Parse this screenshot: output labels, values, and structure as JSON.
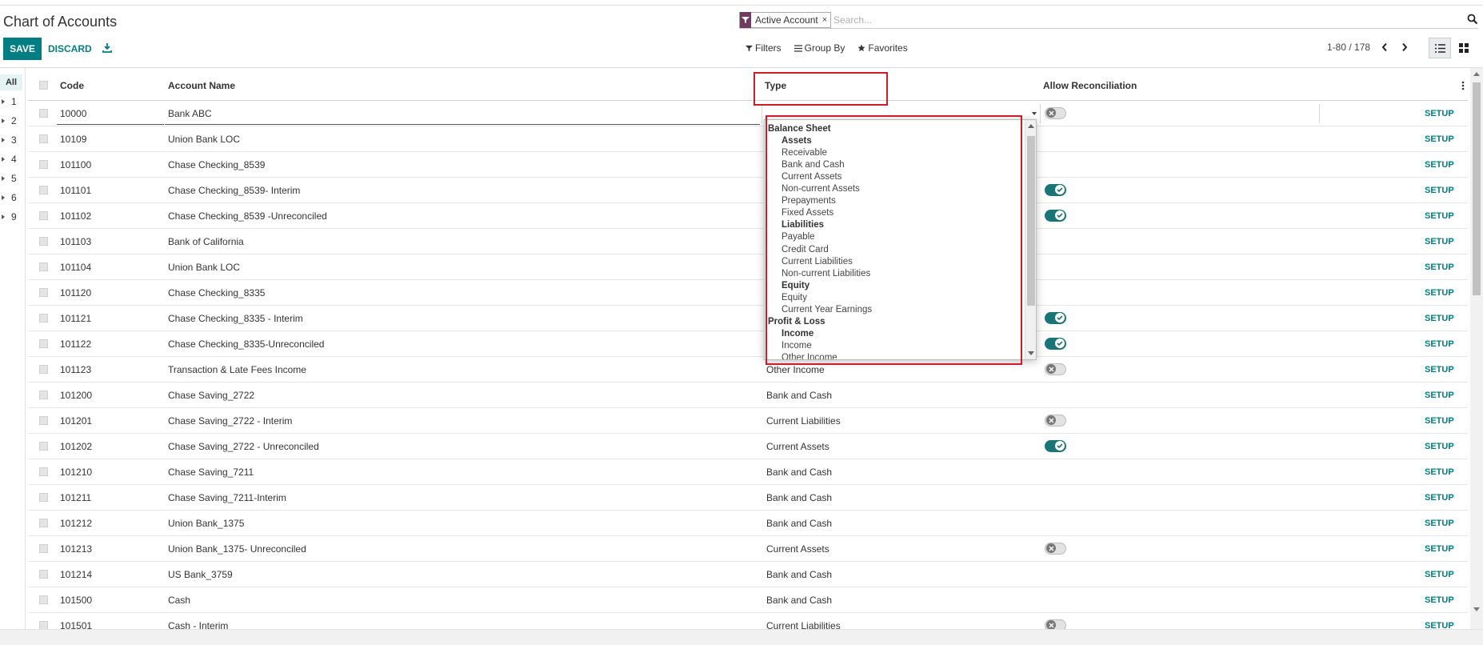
{
  "control_panel": {
    "title": "Chart of Accounts",
    "save_label": "SAVE",
    "discard_label": "DISCARD",
    "download_icon": "download-icon"
  },
  "search": {
    "facet_label": "Active Account",
    "facet_remove": "×",
    "placeholder": "Search..."
  },
  "actions": {
    "filters": "Filters",
    "group_by": "Group By",
    "favorites": "Favorites"
  },
  "pager": {
    "value": "1-80 / 178"
  },
  "search_panel": {
    "all_label": "All",
    "items": [
      "1",
      "2",
      "3",
      "4",
      "5",
      "6",
      "9"
    ]
  },
  "list": {
    "columns": {
      "code": "Code",
      "name": "Account Name",
      "type": "Type",
      "reconcile": "Allow Reconciliation"
    },
    "setup_label": "SETUP",
    "rows": [
      {
        "code": "10000",
        "name": "Bank ABC",
        "type": "",
        "reconcile": "off"
      },
      {
        "code": "10109",
        "name": "Union Bank LOC",
        "type": "",
        "reconcile": ""
      },
      {
        "code": "101100",
        "name": "Chase Checking_8539",
        "type": "",
        "reconcile": ""
      },
      {
        "code": "101101",
        "name": "Chase Checking_8539- Interim",
        "type": "",
        "reconcile": "on"
      },
      {
        "code": "101102",
        "name": "Chase Checking_8539 -Unreconciled",
        "type": "",
        "reconcile": "on"
      },
      {
        "code": "101103",
        "name": "Bank of California",
        "type": "",
        "reconcile": ""
      },
      {
        "code": "101104",
        "name": "Union Bank LOC",
        "type": "",
        "reconcile": ""
      },
      {
        "code": "101120",
        "name": "Chase Checking_8335",
        "type": "",
        "reconcile": ""
      },
      {
        "code": "101121",
        "name": "Chase Checking_8335 - Interim",
        "type": "",
        "reconcile": "on"
      },
      {
        "code": "101122",
        "name": "Chase Checking_8335-Unreconciled",
        "type": "",
        "reconcile": "on"
      },
      {
        "code": "101123",
        "name": "Transaction & Late Fees Income",
        "type": "Other Income",
        "reconcile": "off"
      },
      {
        "code": "101200",
        "name": "Chase Saving_2722",
        "type": "Bank and Cash",
        "reconcile": ""
      },
      {
        "code": "101201",
        "name": "Chase Saving_2722 - Interim",
        "type": "Current Liabilities",
        "reconcile": "off"
      },
      {
        "code": "101202",
        "name": "Chase Saving_2722 - Unreconciled",
        "type": "Current Assets",
        "reconcile": "on"
      },
      {
        "code": "101210",
        "name": "Chase Saving_7211",
        "type": "Bank and Cash",
        "reconcile": ""
      },
      {
        "code": "101211",
        "name": "Chase Saving_7211-Interim",
        "type": "Bank and Cash",
        "reconcile": ""
      },
      {
        "code": "101212",
        "name": "Union Bank_1375",
        "type": "Bank and Cash",
        "reconcile": ""
      },
      {
        "code": "101213",
        "name": "Union Bank_1375- Unreconciled",
        "type": "Current Assets",
        "reconcile": "off"
      },
      {
        "code": "101214",
        "name": "US Bank_3759",
        "type": "Bank and Cash",
        "reconcile": ""
      },
      {
        "code": "101500",
        "name": "Cash",
        "type": "Bank and Cash",
        "reconcile": ""
      },
      {
        "code": "101501",
        "name": "Cash - Interim",
        "type": "Current Liabilities",
        "reconcile": "off"
      }
    ]
  },
  "type_dropdown": {
    "options": [
      {
        "label": "Balance Sheet",
        "level": "g1"
      },
      {
        "label": "Assets",
        "level": "g2"
      },
      {
        "label": "Receivable",
        "level": "opt"
      },
      {
        "label": "Bank and Cash",
        "level": "opt"
      },
      {
        "label": "Current Assets",
        "level": "opt"
      },
      {
        "label": "Non-current Assets",
        "level": "opt"
      },
      {
        "label": "Prepayments",
        "level": "opt"
      },
      {
        "label": "Fixed Assets",
        "level": "opt"
      },
      {
        "label": "Liabilities",
        "level": "g2"
      },
      {
        "label": "Payable",
        "level": "opt"
      },
      {
        "label": "Credit Card",
        "level": "opt"
      },
      {
        "label": "Current Liabilities",
        "level": "opt"
      },
      {
        "label": "Non-current Liabilities",
        "level": "opt"
      },
      {
        "label": "Equity",
        "level": "g2"
      },
      {
        "label": "Equity",
        "level": "opt"
      },
      {
        "label": "Current Year Earnings",
        "level": "opt"
      },
      {
        "label": "Profit & Loss",
        "level": "g1"
      },
      {
        "label": "Income",
        "level": "g2"
      },
      {
        "label": "Income",
        "level": "opt"
      },
      {
        "label": "Other Income",
        "level": "opt"
      }
    ]
  },
  "colors": {
    "primary": "#017e84",
    "facet": "#71395f",
    "highlight_box": "#d11a2a",
    "toggle_on": "#1a7478"
  }
}
